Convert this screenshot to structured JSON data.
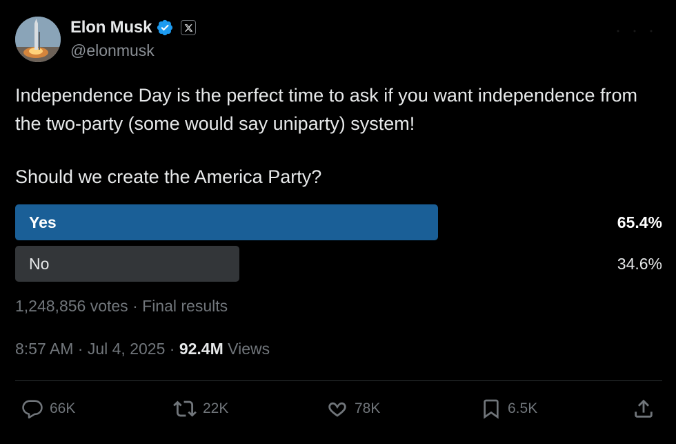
{
  "author": {
    "name": "Elon Musk",
    "handle": "@elonmusk",
    "verified_icon": "verified-badge-icon",
    "affiliate_icon": "x-logo-icon"
  },
  "tweet": {
    "text": "Independence Day is the perfect time to ask if you want independence from the two-party (some would say uniparty) system!",
    "question": "Should we create the America Party?"
  },
  "poll": {
    "options": [
      {
        "label": "Yes",
        "percent": "65.4%",
        "value": 65.4
      },
      {
        "label": "No",
        "percent": "34.6%",
        "value": 34.6
      }
    ],
    "votes": "1,248,856 votes",
    "status": "Final results",
    "separator": "·"
  },
  "meta": {
    "time": "8:57 AM",
    "date": "Jul 4, 2025",
    "views_count": "92.4M",
    "views_label": "Views",
    "separator": "·"
  },
  "actions": {
    "replies": "66K",
    "reposts": "22K",
    "likes": "78K",
    "bookmarks": "6.5K"
  },
  "colors": {
    "background": "#000000",
    "winner_bar": "#1a5f97",
    "loser_bar": "#333639",
    "verified": "#1d9bf0",
    "muted_text": "#71767b"
  }
}
